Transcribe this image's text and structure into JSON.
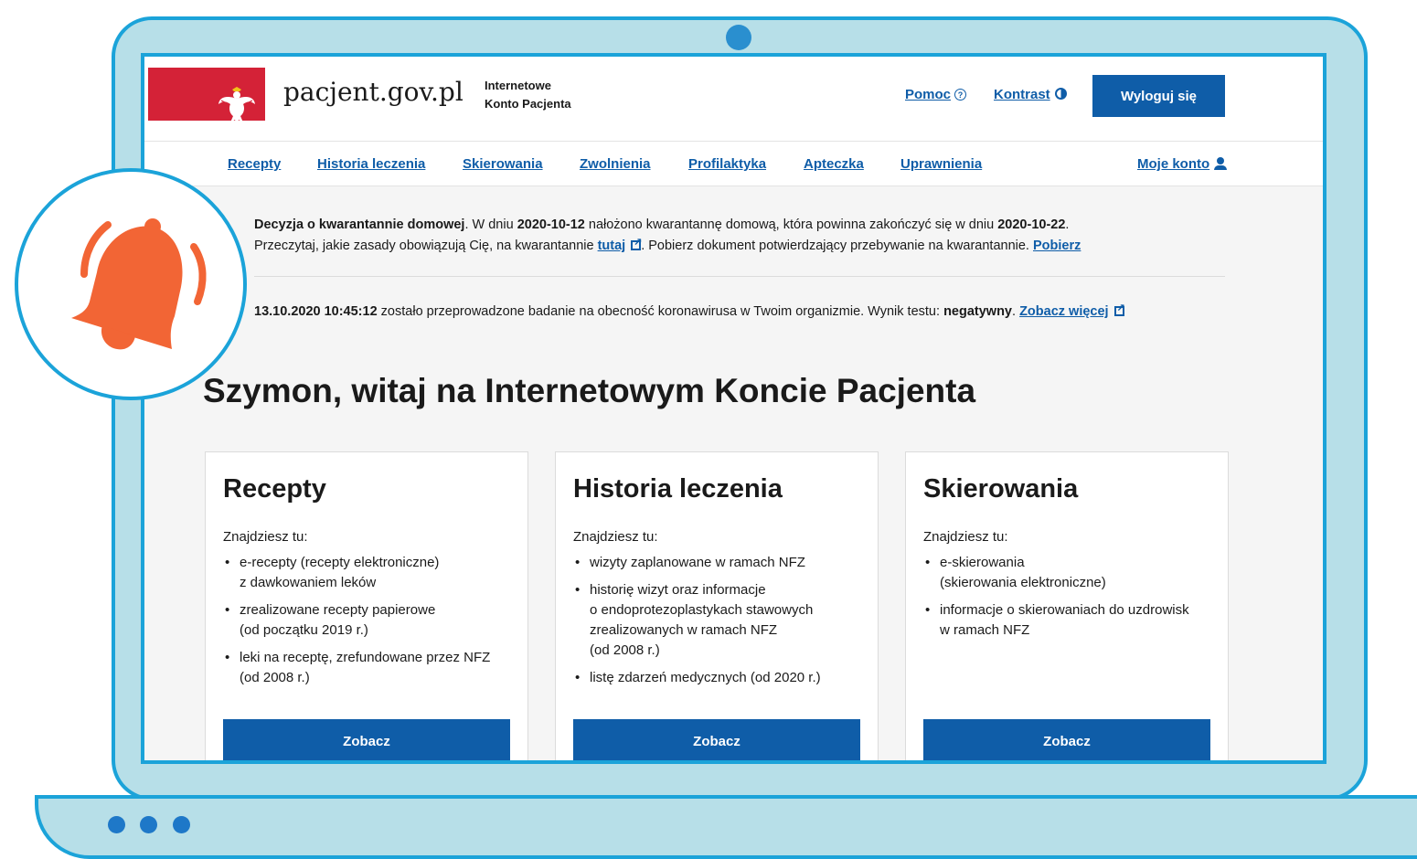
{
  "header": {
    "site_name": "pacjent.gov.pl",
    "subtitle_line1": "Internetowe",
    "subtitle_line2": "Konto Pacjenta",
    "help_label": "Pomoc",
    "contrast_label": "Kontrast",
    "logout_label": "Wyloguj się"
  },
  "nav": {
    "items": [
      {
        "label": "Recepty"
      },
      {
        "label": "Historia leczenia"
      },
      {
        "label": "Skierowania"
      },
      {
        "label": "Zwolnienia"
      },
      {
        "label": "Profilaktyka"
      },
      {
        "label": "Apteczka"
      },
      {
        "label": "Uprawnienia"
      }
    ],
    "account_label": "Moje konto"
  },
  "notices": {
    "quarantine": {
      "title": "Decyzja o kwarantannie domowej",
      "text1": ". W dniu ",
      "date_start": "2020-10-12",
      "text2": " nałożono kwarantannę domową, która powinna zakończyć się w dniu ",
      "date_end": "2020-10-22",
      "text3": ".",
      "line2_text1": "Przeczytaj, jakie zasady obowiązują Cię, na kwarantannie ",
      "link_here": "tutaj",
      "line2_text2": ". Pobierz dokument potwierdzający przebywanie na kwarantannie. ",
      "link_download": "Pobierz"
    },
    "test": {
      "datetime": "13.10.2020 10:45:12",
      "text1": " zostało przeprowadzone badanie na obecność koronawirusa w Twoim organizmie. Wynik testu: ",
      "result": "negatywny",
      "text2": ". ",
      "link_more": "Zobacz więcej"
    }
  },
  "welcome": "Szymon, witaj na Internetowym Koncie Pacjenta",
  "cards": [
    {
      "title": "Recepty",
      "intro": "Znajdziesz tu:",
      "items": [
        "e-recepty (recepty elektroniczne)\nz dawkowaniem leków",
        "zrealizowane recepty papierowe\n(od początku 2019 r.)",
        "leki na receptę, zrefundowane przez NFZ\n(od 2008 r.)"
      ],
      "button": "Zobacz"
    },
    {
      "title": "Historia leczenia",
      "intro": "Znajdziesz tu:",
      "items": [
        "wizyty zaplanowane w ramach NFZ",
        "historię wizyt oraz informacje\no endoprotezoplastykach stawowych\nzrealizowanych w ramach NFZ\n(od 2008 r.)",
        "listę zdarzeń medycznych (od 2020 r.)"
      ],
      "button": "Zobacz"
    },
    {
      "title": "Skierowania",
      "intro": "Znajdziesz tu:",
      "items": [
        "e-skierowania\n(skierowania elektroniczne)",
        "informacje o skierowaniach do uzdrowisk\nw ramach NFZ"
      ],
      "button": "Zobacz"
    }
  ],
  "icons": {
    "bell": "bell-icon",
    "eagle": "polish-eagle-icon",
    "help": "question-circle-icon",
    "contrast": "contrast-icon",
    "account": "person-icon",
    "external": "external-link-icon"
  },
  "colors": {
    "primary": "#0f5da8",
    "flag_red": "#d42237",
    "frame": "#1ba3d9",
    "frame_fill": "#b7dfe8",
    "bell": "#f26535"
  }
}
